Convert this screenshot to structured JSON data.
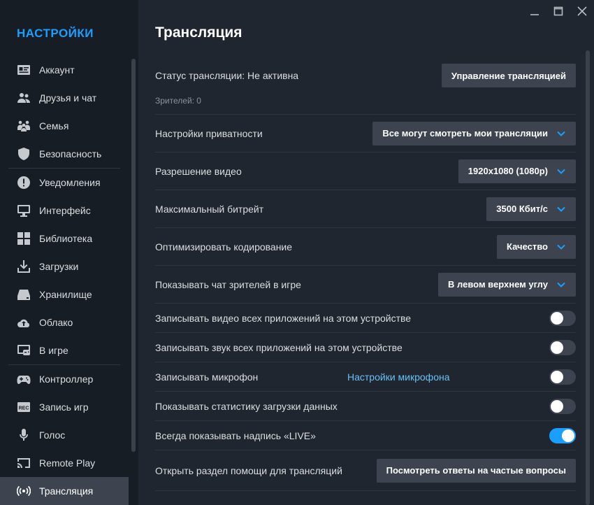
{
  "window": {
    "controls": [
      "minimize-icon",
      "maximize-icon",
      "close-icon"
    ]
  },
  "sidebar": {
    "title": "НАСТРОЙКИ",
    "items": [
      {
        "label": "Аккаунт",
        "icon": "id-card-icon"
      },
      {
        "label": "Друзья и чат",
        "icon": "friends-icon"
      },
      {
        "label": "Семья",
        "icon": "family-icon"
      },
      {
        "label": "Безопасность",
        "icon": "shield-icon"
      },
      {
        "label": "Уведомления",
        "icon": "alert-icon"
      },
      {
        "label": "Интерфейс",
        "icon": "monitor-icon"
      },
      {
        "label": "Библиотека",
        "icon": "grid-icon"
      },
      {
        "label": "Загрузки",
        "icon": "download-icon"
      },
      {
        "label": "Хранилище",
        "icon": "drive-icon"
      },
      {
        "label": "Облако",
        "icon": "cloud-icon"
      },
      {
        "label": "В игре",
        "icon": "ingame-icon"
      },
      {
        "label": "Контроллер",
        "icon": "gamepad-icon"
      },
      {
        "label": "Запись игр",
        "icon": "rec-icon"
      },
      {
        "label": "Голос",
        "icon": "microphone-icon"
      },
      {
        "label": "Remote Play",
        "icon": "cast-icon"
      },
      {
        "label": "Трансляция",
        "icon": "broadcast-icon"
      }
    ],
    "active_index": 15
  },
  "main": {
    "title": "Трансляция",
    "status_label": "Статус трансляции: Не активна",
    "manage_button": "Управление трансляцией",
    "viewers": "Зрителей: 0",
    "privacy": {
      "label": "Настройки приватности",
      "value": "Все могут смотреть мои трансляции"
    },
    "resolution": {
      "label": "Разрешение видео",
      "value": "1920x1080 (1080p)"
    },
    "bitrate": {
      "label": "Максимальный битрейт",
      "value": "3500 Кбит/с"
    },
    "encoding": {
      "label": "Оптимизировать кодирование",
      "value": "Качество"
    },
    "chat": {
      "label": "Показывать чат зрителей в игре",
      "value": "В левом верхнем углу"
    },
    "record_video": {
      "label": "Записывать видео всех приложений на этом устройстве",
      "on": false
    },
    "record_audio": {
      "label": "Записывать звук всех приложений на этом устройстве",
      "on": false
    },
    "record_mic": {
      "label": "Записывать микрофон",
      "link": "Настройки микрофона",
      "on": false
    },
    "upload_stats": {
      "label": "Показывать статистику загрузки данных",
      "on": false
    },
    "live_badge": {
      "label": "Всегда показывать надпись «LIVE»",
      "on": true
    },
    "help": {
      "label": "Открыть раздел помощи для трансляций",
      "button": "Посмотреть ответы на частые вопросы"
    }
  },
  "colors": {
    "accent": "#1a9fff",
    "link": "#67c1f5",
    "panel": "#3d4450"
  }
}
